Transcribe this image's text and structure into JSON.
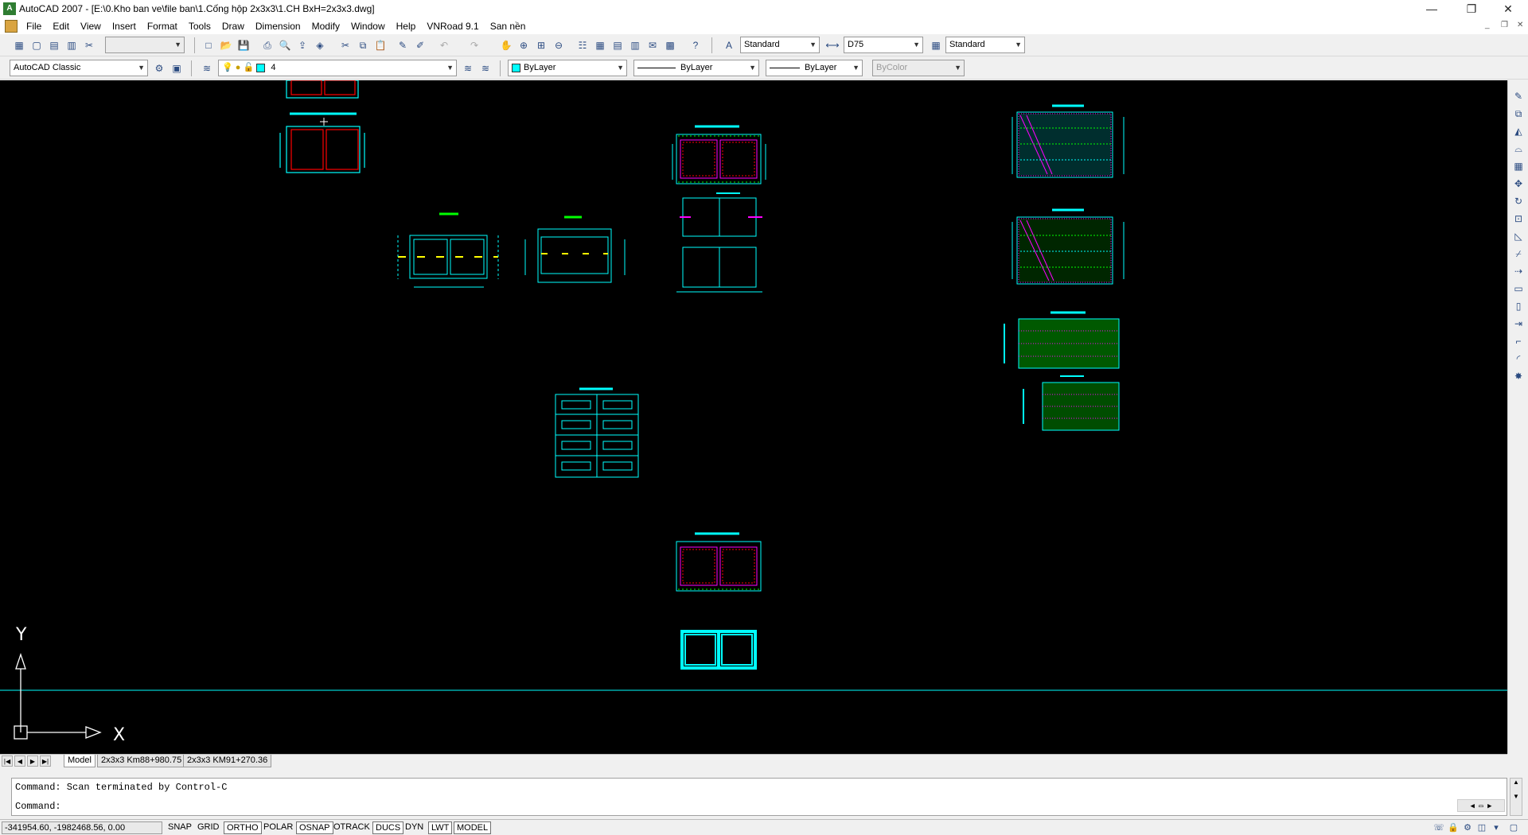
{
  "window": {
    "title": "AutoCAD 2007 - [E:\\0.Kho ban ve\\file ban\\1.Cống hộp 2x3x3\\1.CH BxH=2x3x3.dwg]",
    "app_logo_text": "A",
    "minimize": "—",
    "restore": "❐",
    "close": "✕"
  },
  "menu": [
    "File",
    "Edit",
    "View",
    "Insert",
    "Format",
    "Tools",
    "Draw",
    "Dimension",
    "Modify",
    "Window",
    "Help",
    "VNRoad 9.1",
    "San nền"
  ],
  "toolbar1": {
    "text_style": "Standard",
    "dim_style": "D75",
    "table_style": "Standard"
  },
  "toolbar2": {
    "workspace": "AutoCAD Classic",
    "layer": "4",
    "color": "ByLayer",
    "linetype": "ByLayer",
    "lineweight": "ByLayer",
    "plotstyle": "ByColor",
    "color_swatch": "#00ffff"
  },
  "ucs": {
    "y_label": "Y",
    "x_label": "X"
  },
  "tabs": {
    "model": "Model",
    "layout1": "2x3x3 Km88+980.75",
    "layout2": "2x3x3 KM91+270.36"
  },
  "command": {
    "line1": "Command: Scan terminated by Control-C",
    "line2": "Command:"
  },
  "status": {
    "coords": "-341954.60, -1982468.56, 0.00",
    "buttons": [
      {
        "label": "SNAP",
        "on": false
      },
      {
        "label": "GRID",
        "on": false
      },
      {
        "label": "ORTHO",
        "on": true
      },
      {
        "label": "POLAR",
        "on": false
      },
      {
        "label": "OSNAP",
        "on": true
      },
      {
        "label": "OTRACK",
        "on": false
      },
      {
        "label": "DUCS",
        "on": true
      },
      {
        "label": "DYN",
        "on": false
      },
      {
        "label": "LWT",
        "on": true
      },
      {
        "label": "MODEL",
        "on": true
      }
    ]
  },
  "colors": {
    "canvas": "#000000",
    "cyan": "#00ffff",
    "red": "#ff0000",
    "magenta": "#ff00ff",
    "green": "#00ff00",
    "yellow": "#ffff00"
  }
}
